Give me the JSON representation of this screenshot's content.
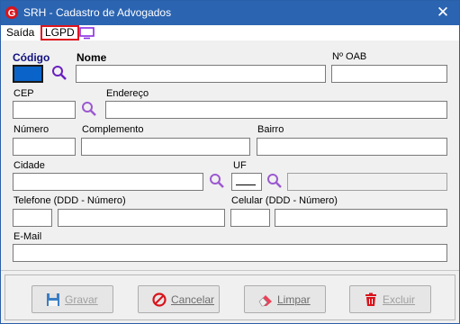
{
  "window": {
    "title": "SRH - Cadastro de Advogados",
    "close_glyph": "✕"
  },
  "menu": {
    "saida": "Saída",
    "lgpd": "LGPD"
  },
  "labels": {
    "codigo": "Código",
    "nome": "Nome",
    "oab": "Nº OAB",
    "cep": "CEP",
    "endereco": "Endereço",
    "numero": "Número",
    "complemento": "Complemento",
    "bairro": "Bairro",
    "cidade": "Cidade",
    "uf": "UF",
    "telefone": "Telefone (DDD - Número)",
    "celular": "Celular (DDD - Número)",
    "email": "E-Mail"
  },
  "buttons": {
    "gravar": "Gravar",
    "cancelar": "Cancelar",
    "limpar": "Limpar",
    "excluir": "Excluir"
  },
  "colors": {
    "titlebar": "#2b64b1",
    "lgpd_border": "#e0141e",
    "magnifier": "#8a2be2",
    "monitor": "#8a2be2"
  }
}
